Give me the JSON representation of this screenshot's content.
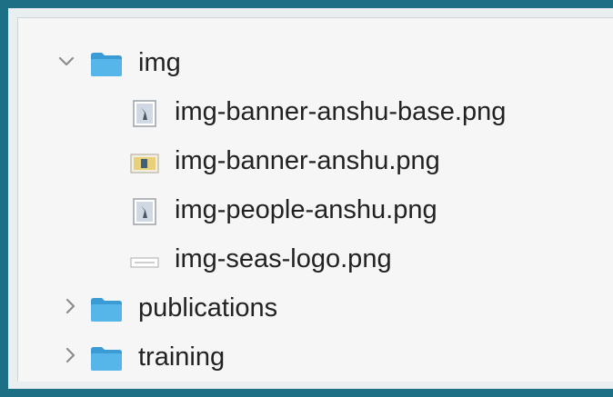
{
  "tree": {
    "img": {
      "label": "img",
      "expanded": true,
      "children": [
        {
          "label": "img-banner-anshu-base.png",
          "icon": "image-file-icon"
        },
        {
          "label": "img-banner-anshu.png",
          "icon": "image-thumbnail-icon"
        },
        {
          "label": "img-people-anshu.png",
          "icon": "image-file-icon"
        },
        {
          "label": "img-seas-logo.png",
          "icon": "logo-thumbnail-icon"
        }
      ]
    },
    "publications": {
      "label": "publications",
      "expanded": false
    },
    "training": {
      "label": "training",
      "expanded": false
    }
  },
  "colors": {
    "folder": "#56b6ea",
    "folder_dark": "#3b9bd4",
    "border": "#1d6f86"
  }
}
